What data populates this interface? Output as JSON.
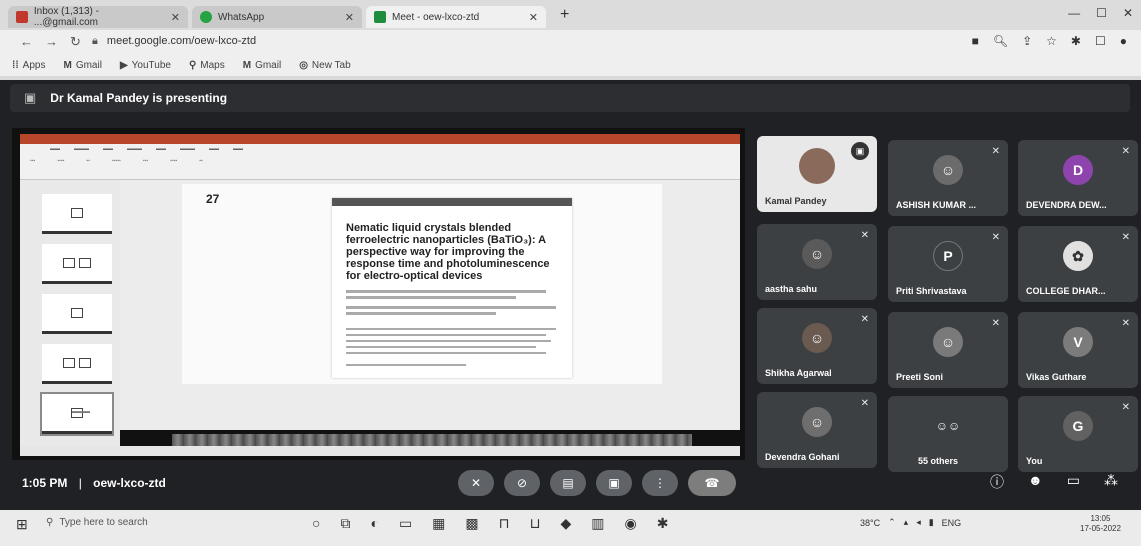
{
  "browser": {
    "tabs": [
      {
        "label": "Inbox (1,313) - ...@gmail.com",
        "active": false
      },
      {
        "label": "WhatsApp",
        "active": false
      },
      {
        "label": "Meet - oew-lxco-ztd",
        "active": true
      }
    ],
    "url": "meet.google.com/oew-lxco-ztd",
    "bookmarks": [
      "Apps",
      "Gmail",
      "YouTube",
      "Maps",
      "Gmail",
      "New Tab"
    ]
  },
  "meet": {
    "presenting_text": "Dr Kamal Pandey is presenting",
    "time": "1:05 PM",
    "separator": "|",
    "meeting_code": "oew-lxco-ztd",
    "participants": [
      {
        "name": "Kamal Pandey",
        "type": "video"
      },
      {
        "name": "ASHISH KUMAR ...",
        "type": "photo",
        "color": "#6b6b6b"
      },
      {
        "name": "DEVENDRA DEW...",
        "type": "initial",
        "initial": "D",
        "color": "#8e44ad"
      },
      {
        "name": "aastha sahu",
        "type": "photo",
        "color": "#5a5a5a"
      },
      {
        "name": "Priti Shrivastava",
        "type": "initial",
        "initial": "P",
        "color": "#3c4043"
      },
      {
        "name": "COLLEGE DHAR...",
        "type": "photo",
        "color": "#e0e0e0"
      },
      {
        "name": "Shikha Agarwal",
        "type": "photo",
        "color": "#6a5a50"
      },
      {
        "name": "Preeti Soni",
        "type": "photo",
        "color": "#7a7a7a"
      },
      {
        "name": "Vikas Guthare",
        "type": "initial",
        "initial": "V",
        "color": "#7b7b7b"
      },
      {
        "name": "Devendra Gohani",
        "type": "photo",
        "color": "#6e6e6e"
      },
      {
        "name": "55 others",
        "type": "others"
      },
      {
        "name": "You",
        "type": "initial",
        "initial": "G",
        "color": "#616161"
      }
    ]
  },
  "slide": {
    "number": "27",
    "paper_title": "Nematic liquid crystals blended ferroelectric nanoparticles (BaTiO₃): A perspective way for improving the response time and photoluminescence for electro-optical devices"
  },
  "taskbar": {
    "search_placeholder": "Type here to search",
    "temperature": "38°C",
    "language": "ENG",
    "time": "13:05",
    "date": "17-05-2022"
  }
}
